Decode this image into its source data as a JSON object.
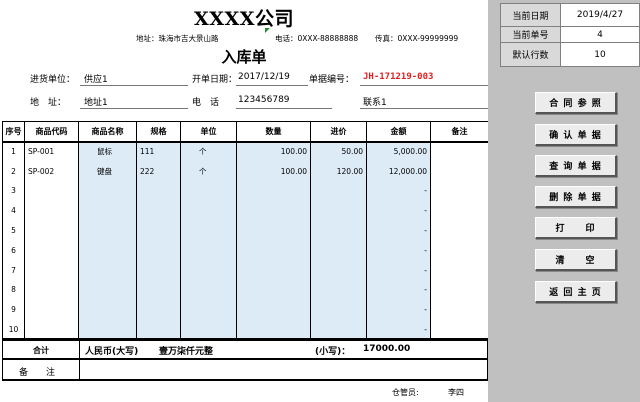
{
  "header": {
    "company": "XXXX公司",
    "address": "地址：珠海市吉大景山路",
    "phone": "电话：0XXX-88888888",
    "fax": "传真：0XXX-99999999",
    "doc_title": "入库单"
  },
  "form": {
    "supplier_label": "进货单位：",
    "supplier_value": "供应1",
    "date_label": "开单日期：",
    "date_value": "2017/12/19",
    "docno_label": "单据编号：",
    "docno_value": "JH-171219-003",
    "addr_label": "地　址：",
    "addr_value": "地址1",
    "tel_label": "电　话",
    "tel_value": "123456789",
    "contact_value": "联系1"
  },
  "table": {
    "headers": [
      "序号",
      "商品代码",
      "商品名称",
      "规格",
      "单位",
      "数量",
      "进价",
      "金额",
      "备注"
    ],
    "rows": [
      [
        "1",
        "SP-001",
        "鼠标",
        "111",
        "个",
        "100.00",
        "50.00",
        "5,000.00",
        ""
      ],
      [
        "2",
        "SP-002",
        "键盘",
        "222",
        "个",
        "100.00",
        "120.00",
        "12,000.00",
        ""
      ],
      [
        "3",
        "",
        "",
        "",
        "",
        "",
        "",
        "-",
        ""
      ],
      [
        "4",
        "",
        "",
        "",
        "",
        "",
        "",
        "-",
        ""
      ],
      [
        "5",
        "",
        "",
        "",
        "",
        "",
        "",
        "-",
        ""
      ],
      [
        "6",
        "",
        "",
        "",
        "",
        "",
        "",
        "-",
        ""
      ],
      [
        "7",
        "",
        "",
        "",
        "",
        "",
        "",
        "-",
        ""
      ],
      [
        "8",
        "",
        "",
        "",
        "",
        "",
        "",
        "-",
        ""
      ],
      [
        "9",
        "",
        "",
        "",
        "",
        "",
        "",
        "-",
        ""
      ],
      [
        "10",
        "",
        "",
        "",
        "",
        "",
        "",
        "-",
        ""
      ]
    ]
  },
  "summary": {
    "total_label": "合计",
    "upper_label": "人民币(大写)",
    "upper_value": "壹万柒仟元整",
    "lower_label": "(小写)：",
    "lower_value": "17000.00",
    "remark_label": "备　　注"
  },
  "footer": {
    "keeper_label": "仓管员:",
    "keeper_value": "李四"
  },
  "side": {
    "date_label": "当前日期",
    "date_value": "2019/4/27",
    "docno_label": "当前单号",
    "docno_value": "4",
    "rows_label": "默认行数",
    "rows_value": "10",
    "buttons": [
      "合 同 参 照",
      "确 认 单 据",
      "查 询 单 据",
      "删 除 单 据",
      "打　　印",
      "清　　空",
      "返 回 主 页"
    ]
  },
  "colors": {
    "accent_red": "#e02020",
    "cell_blue": "#ddebf7",
    "panel_gray": "#c0c0c0"
  }
}
